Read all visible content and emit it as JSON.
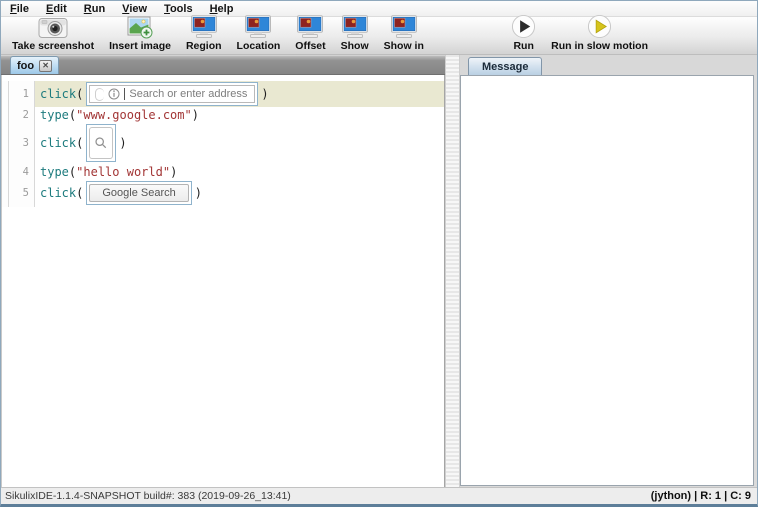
{
  "menu": {
    "items": [
      {
        "label": "File"
      },
      {
        "label": "Edit"
      },
      {
        "label": "Run"
      },
      {
        "label": "View"
      },
      {
        "label": "Tools"
      },
      {
        "label": "Help"
      }
    ]
  },
  "toolbar": {
    "buttons": [
      {
        "label": "Take screenshot",
        "icon": "camera-icon"
      },
      {
        "label": "Insert image",
        "icon": "insert-image-icon"
      },
      {
        "label": "Region",
        "icon": "monitor-region-icon"
      },
      {
        "label": "Location",
        "icon": "monitor-region-icon"
      },
      {
        "label": "Offset",
        "icon": "monitor-region-icon"
      },
      {
        "label": "Show",
        "icon": "monitor-region-icon"
      },
      {
        "label": "Show in",
        "icon": "monitor-region-icon"
      },
      {
        "label": "Run",
        "icon": "run-icon"
      },
      {
        "label": "Run in slow motion",
        "icon": "run-slow-icon"
      }
    ]
  },
  "editor": {
    "tab_label": "foo",
    "lines": [
      {
        "no": "1",
        "func": "click",
        "open": "(",
        "close": ")",
        "thumb": {
          "kind": "address-bar",
          "info_icon": "info-icon",
          "placeholder": "Search or enter address"
        }
      },
      {
        "no": "2",
        "func": "type",
        "open": "(",
        "string": "\"www.google.com\"",
        "close": ")"
      },
      {
        "no": "3",
        "func": "click",
        "open": "(",
        "close": ")",
        "thumb": {
          "kind": "magnifier",
          "icon": "magnifier-icon"
        }
      },
      {
        "no": "4",
        "func": "type",
        "open": "(",
        "string": "\"hello world\"",
        "close": ")"
      },
      {
        "no": "5",
        "func": "click",
        "open": "(",
        "close": ")",
        "thumb": {
          "kind": "button",
          "label": "Google Search"
        }
      }
    ]
  },
  "message_panel": {
    "tab_label": "Message"
  },
  "status": {
    "left": "SikulixIDE-1.1.4-SNAPSHOT build#: 383 (2019-09-26_13:41)",
    "right": "(jython) | R: 1 | C: 9"
  },
  "colors": {
    "keyword": "#1d7b7e",
    "string": "#a23535",
    "current_line_highlight": "#e9e8d1",
    "selected_tab_blue": "#bddcf2",
    "tabbar_gray": "#8a8a8a",
    "thumb_border_blue": "#8fb3cc",
    "run_triangle": "#2b2b2b",
    "slow_run_triangle": "#d6c41c",
    "monitor_screen_blue": "#2f86d8",
    "monitor_region_red": "#8e2320"
  }
}
